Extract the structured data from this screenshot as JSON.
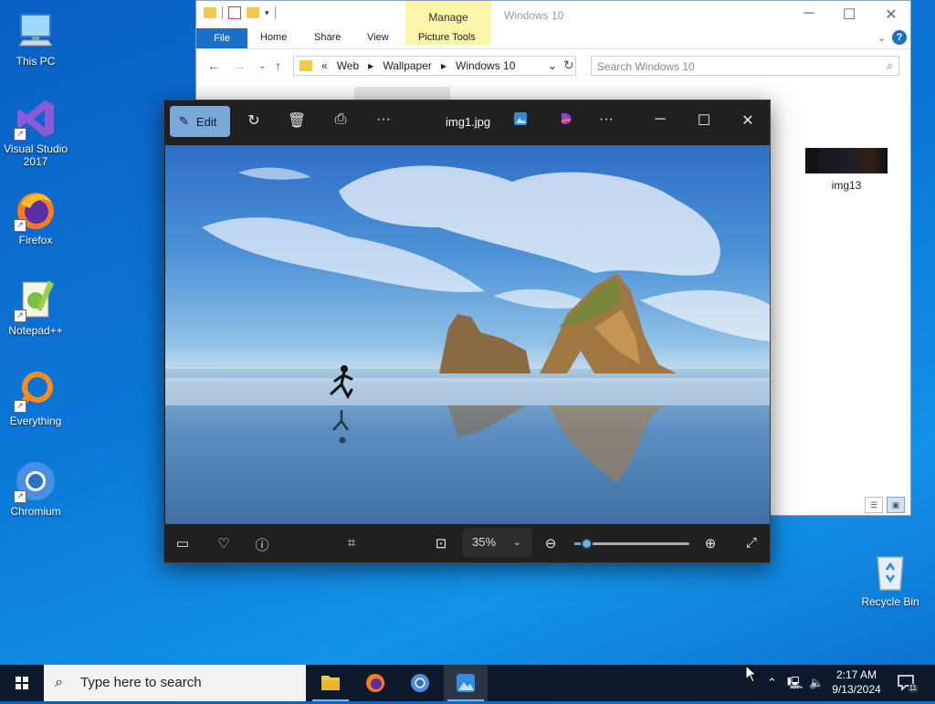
{
  "desktop": {
    "icons": [
      {
        "label": "This PC"
      },
      {
        "label": "Visual Studio 2017"
      },
      {
        "label": "Firefox"
      },
      {
        "label": "Notepad++"
      },
      {
        "label": "Everything"
      },
      {
        "label": "Chromium"
      },
      {
        "label": "Recycle Bin"
      }
    ]
  },
  "explorer": {
    "title": "Windows 10",
    "contextual_tab": "Manage",
    "tabs": [
      "File",
      "Home",
      "Share",
      "View",
      "Picture Tools"
    ],
    "breadcrumb": [
      "«",
      "Web",
      "Wallpaper",
      "Windows 10"
    ],
    "search_placeholder": "Search Windows 10",
    "files": [
      {
        "name": "img13"
      }
    ]
  },
  "photos": {
    "edit_label": "Edit",
    "file_name": "img1.jpg",
    "zoom": "35%",
    "zoom_slider_fraction": 0.1
  },
  "taskbar": {
    "search_placeholder": "Type here to search",
    "time": "2:17 AM",
    "date": "9/13/2024",
    "notification_count": "11"
  },
  "colors": {
    "accent": "#1a6fc7",
    "manage_tab": "#fbf5a9",
    "photos_bg": "#202020",
    "taskbar": "#0e1a2b"
  }
}
